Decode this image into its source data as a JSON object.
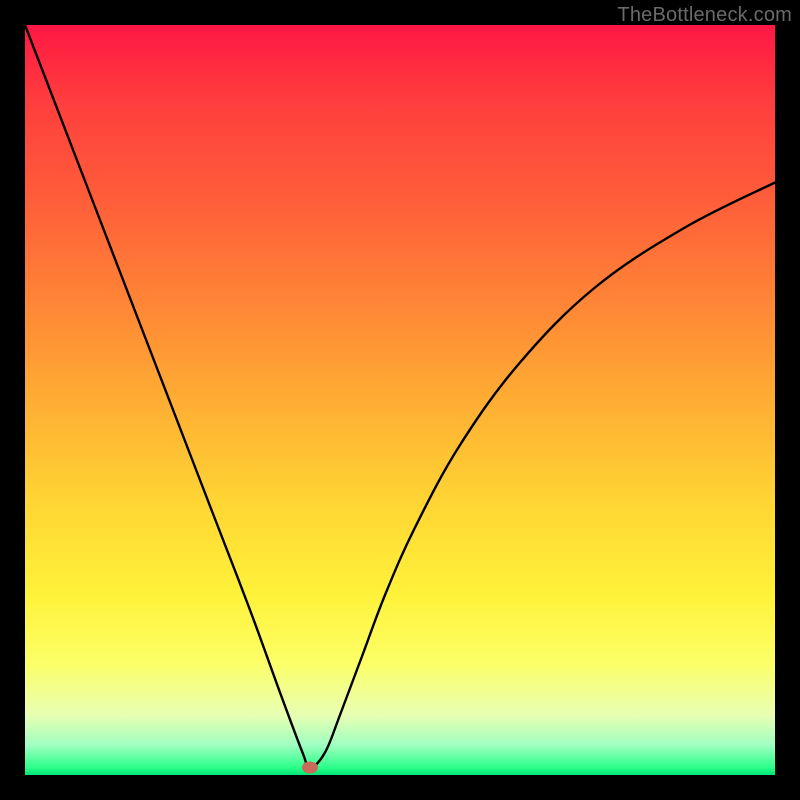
{
  "watermark": {
    "text": "TheBottleneck.com"
  },
  "chart_data": {
    "type": "line",
    "title": "",
    "xlabel": "",
    "ylabel": "",
    "x_range": [
      0,
      100
    ],
    "y_range": [
      0,
      100
    ],
    "series": [
      {
        "name": "bottleneck-curve",
        "x": [
          0,
          5,
          10,
          15,
          20,
          25,
          30,
          34,
          37,
          38,
          40,
          42,
          45,
          48,
          52,
          58,
          66,
          76,
          88,
          100
        ],
        "values": [
          100,
          87,
          74,
          61,
          48,
          35,
          22,
          11,
          3,
          1,
          3,
          8,
          16,
          24,
          33,
          44,
          55,
          65,
          73,
          79
        ]
      }
    ],
    "marker": {
      "name": "optimum-point",
      "x": 38,
      "y": 1,
      "color": "#c96a5a",
      "rx": 8,
      "ry": 6
    },
    "gradient_stops": [
      {
        "offset": 0,
        "color": "#ff1744"
      },
      {
        "offset": 50,
        "color": "#ffad33"
      },
      {
        "offset": 85,
        "color": "#fcff66"
      },
      {
        "offset": 100,
        "color": "#00e676"
      }
    ]
  }
}
